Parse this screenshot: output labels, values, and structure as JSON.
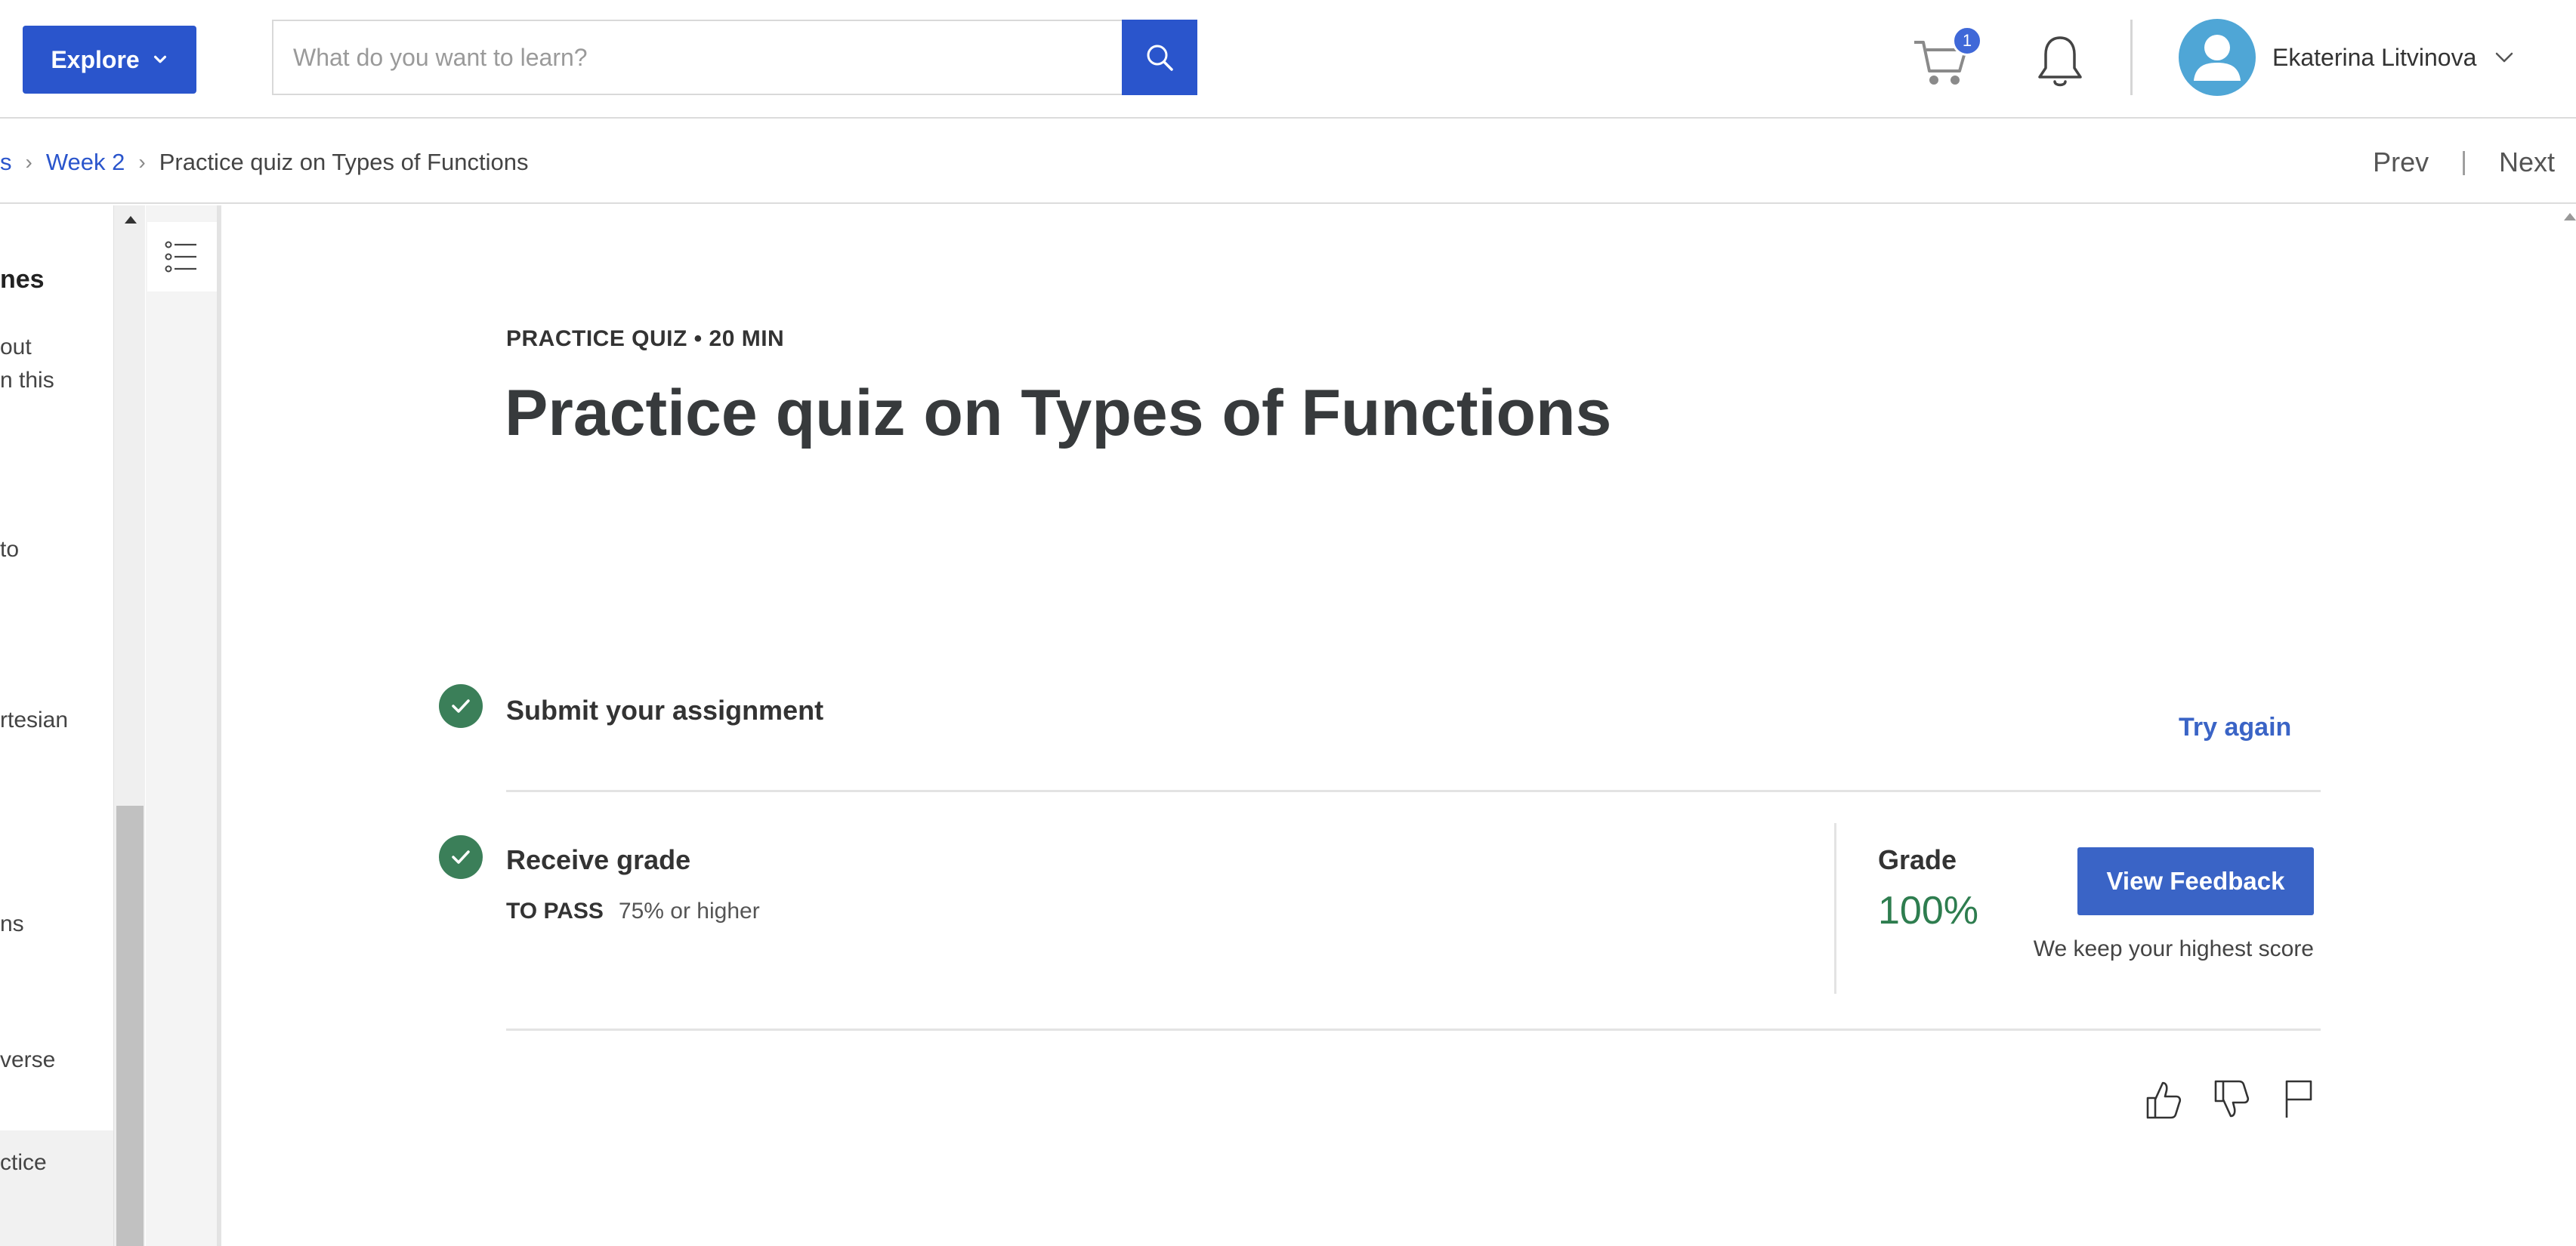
{
  "header": {
    "explore_label": "Explore",
    "search_placeholder": "What do you want to learn?",
    "cart_count": "1",
    "user_name": "Ekaterina Litvinova"
  },
  "breadcrumb": {
    "items": [
      "s",
      "Week 2"
    ],
    "current": "Practice quiz on Types of Functions"
  },
  "nav": {
    "prev": "Prev",
    "separator": "|",
    "next": "Next"
  },
  "sidebar": {
    "heading_fragment": "nes",
    "fragments": [
      "out",
      "n this",
      "to",
      "rtesian",
      "ns",
      "verse",
      "ctice"
    ]
  },
  "quiz": {
    "kicker": "PRACTICE QUIZ • 20 MIN",
    "title": "Practice quiz on Types of Functions",
    "step1_label": "Submit your assignment",
    "try_again": "Try again",
    "step2_label": "Receive grade",
    "to_pass_label": "TO PASS",
    "to_pass_value": "75% or higher",
    "grade_label": "Grade",
    "grade_value": "100%",
    "view_feedback": "View Feedback",
    "keep_score": "We keep your highest score"
  },
  "colors": {
    "primary_blue": "#2a55cc",
    "link_blue": "#3a64c6",
    "success_green": "#3b7f59",
    "grade_green": "#2e7d4f"
  }
}
